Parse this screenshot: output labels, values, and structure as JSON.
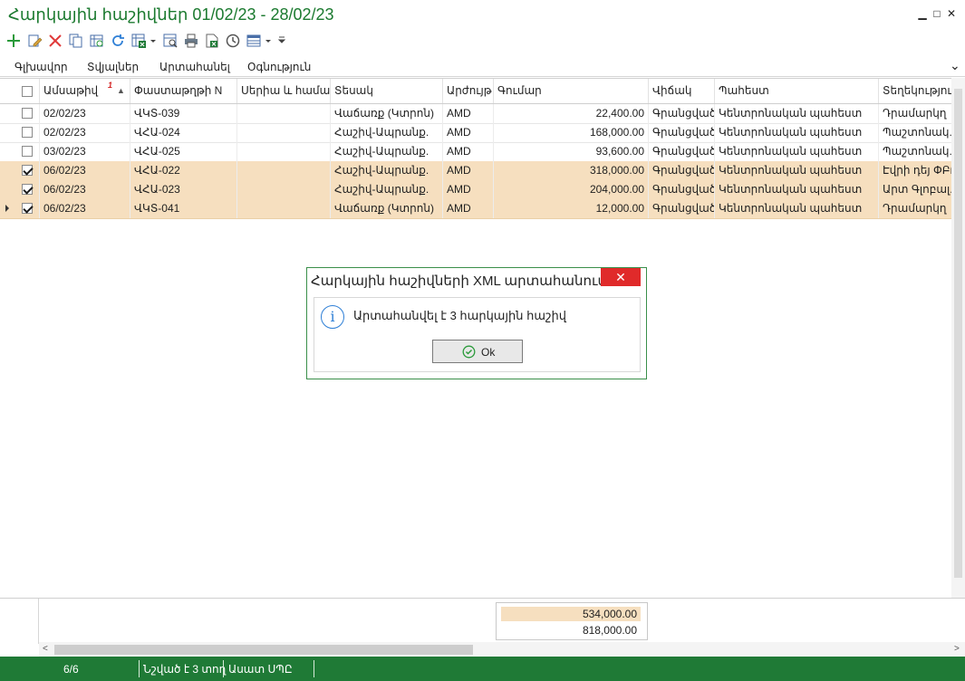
{
  "window": {
    "title": "Հարկային հաշիվներ 01/02/23 - 28/02/23",
    "minimize": "▁",
    "maximize": "□",
    "close": "✕"
  },
  "toolbar": {
    "icons": [
      "add-icon",
      "edit-icon",
      "delete-icon",
      "copy-icon",
      "refresh-table-icon",
      "reload-icon",
      "excel-export-icon",
      "dropdown-arrow-icon",
      "preview-icon",
      "print-icon",
      "excel-icon",
      "history-icon",
      "layout-icon",
      "dropdown-arrow-icon",
      "overflow-icon"
    ]
  },
  "menu": {
    "items": [
      "Գլխավոր",
      "Տվյալներ",
      "Արտահանել",
      "Օգնություն"
    ],
    "expand": "⌄"
  },
  "grid": {
    "sort_badge": "1",
    "columns": [
      "Ամսաթիվ",
      "Փաստաթղթի N",
      "Սերիա և համար",
      "Տեսակ",
      "Արժույթ",
      "Գումար",
      "Վիճակ",
      "Պահեստ",
      "Տեղեկություն"
    ],
    "rows": [
      {
        "date": "02/02/23",
        "doc": "ՎԿՏ-039",
        "series": "",
        "type": "Վաճառք (Կտրոն)",
        "currency": "AMD",
        "amount": "22,400.00",
        "status": "Գրանցված",
        "warehouse": "Կենտրոնական պահեստ",
        "info": "Դրամարկղ",
        "checked": false,
        "selected": false
      },
      {
        "date": "02/02/23",
        "doc": "ՎՀԱ-024",
        "series": "",
        "type": "Հաշիվ-Ապրանք.",
        "currency": "AMD",
        "amount": "168,000.00",
        "status": "Գրանցված",
        "warehouse": "Կենտրոնական պահեստ",
        "info": "Պաշտոնակ...",
        "checked": false,
        "selected": false
      },
      {
        "date": "03/02/23",
        "doc": "ՎՀԱ-025",
        "series": "",
        "type": "Հաշիվ-Ապրանք.",
        "currency": "AMD",
        "amount": "93,600.00",
        "status": "Գրանցված",
        "warehouse": "Կենտրոնական պահեստ",
        "info": "Պաշտոնակ...",
        "checked": false,
        "selected": false
      },
      {
        "date": "06/02/23",
        "doc": "ՎՀԱ-022",
        "series": "",
        "type": "Հաշիվ-Ապրանք.",
        "currency": "AMD",
        "amount": "318,000.00",
        "status": "Գրանցված",
        "warehouse": "Կենտրոնական պահեստ",
        "info": "Էվրի դեյ ՓԲԸ",
        "checked": true,
        "selected": true
      },
      {
        "date": "06/02/23",
        "doc": "ՎՀԱ-023",
        "series": "",
        "type": "Հաշիվ-Ապրանք.",
        "currency": "AMD",
        "amount": "204,000.00",
        "status": "Գրանցված",
        "warehouse": "Կենտրոնական պահեստ",
        "info": "Արտ Գլոբալ...",
        "checked": true,
        "selected": true
      },
      {
        "date": "06/02/23",
        "doc": "ՎԿՏ-041",
        "series": "",
        "type": "Վաճառք (Կտրոն)",
        "currency": "AMD",
        "amount": "12,000.00",
        "status": "Գրանցված",
        "warehouse": "Կենտրոնական պահեստ",
        "info": "Դրամարկղ",
        "checked": true,
        "selected": true
      }
    ]
  },
  "totals": {
    "selected_sum": "534,000.00",
    "total_sum": "818,000.00"
  },
  "statusbar": {
    "count": "6/6",
    "selection": "Նշված է 3 տող",
    "user": "Ասատ ՍՊԸ"
  },
  "dialog": {
    "title": "Հարկային հաշիվների XML արտահանում",
    "message": "Արտահանվել է 3 հարկային հաշիվ",
    "ok_label": "Ok",
    "close": "✕",
    "info_glyph": "i"
  },
  "colors": {
    "brand_green": "#1f7a36",
    "selected_row": "#f6dfbf",
    "close_red": "#e02a2a",
    "info_blue": "#2e7fd6"
  }
}
